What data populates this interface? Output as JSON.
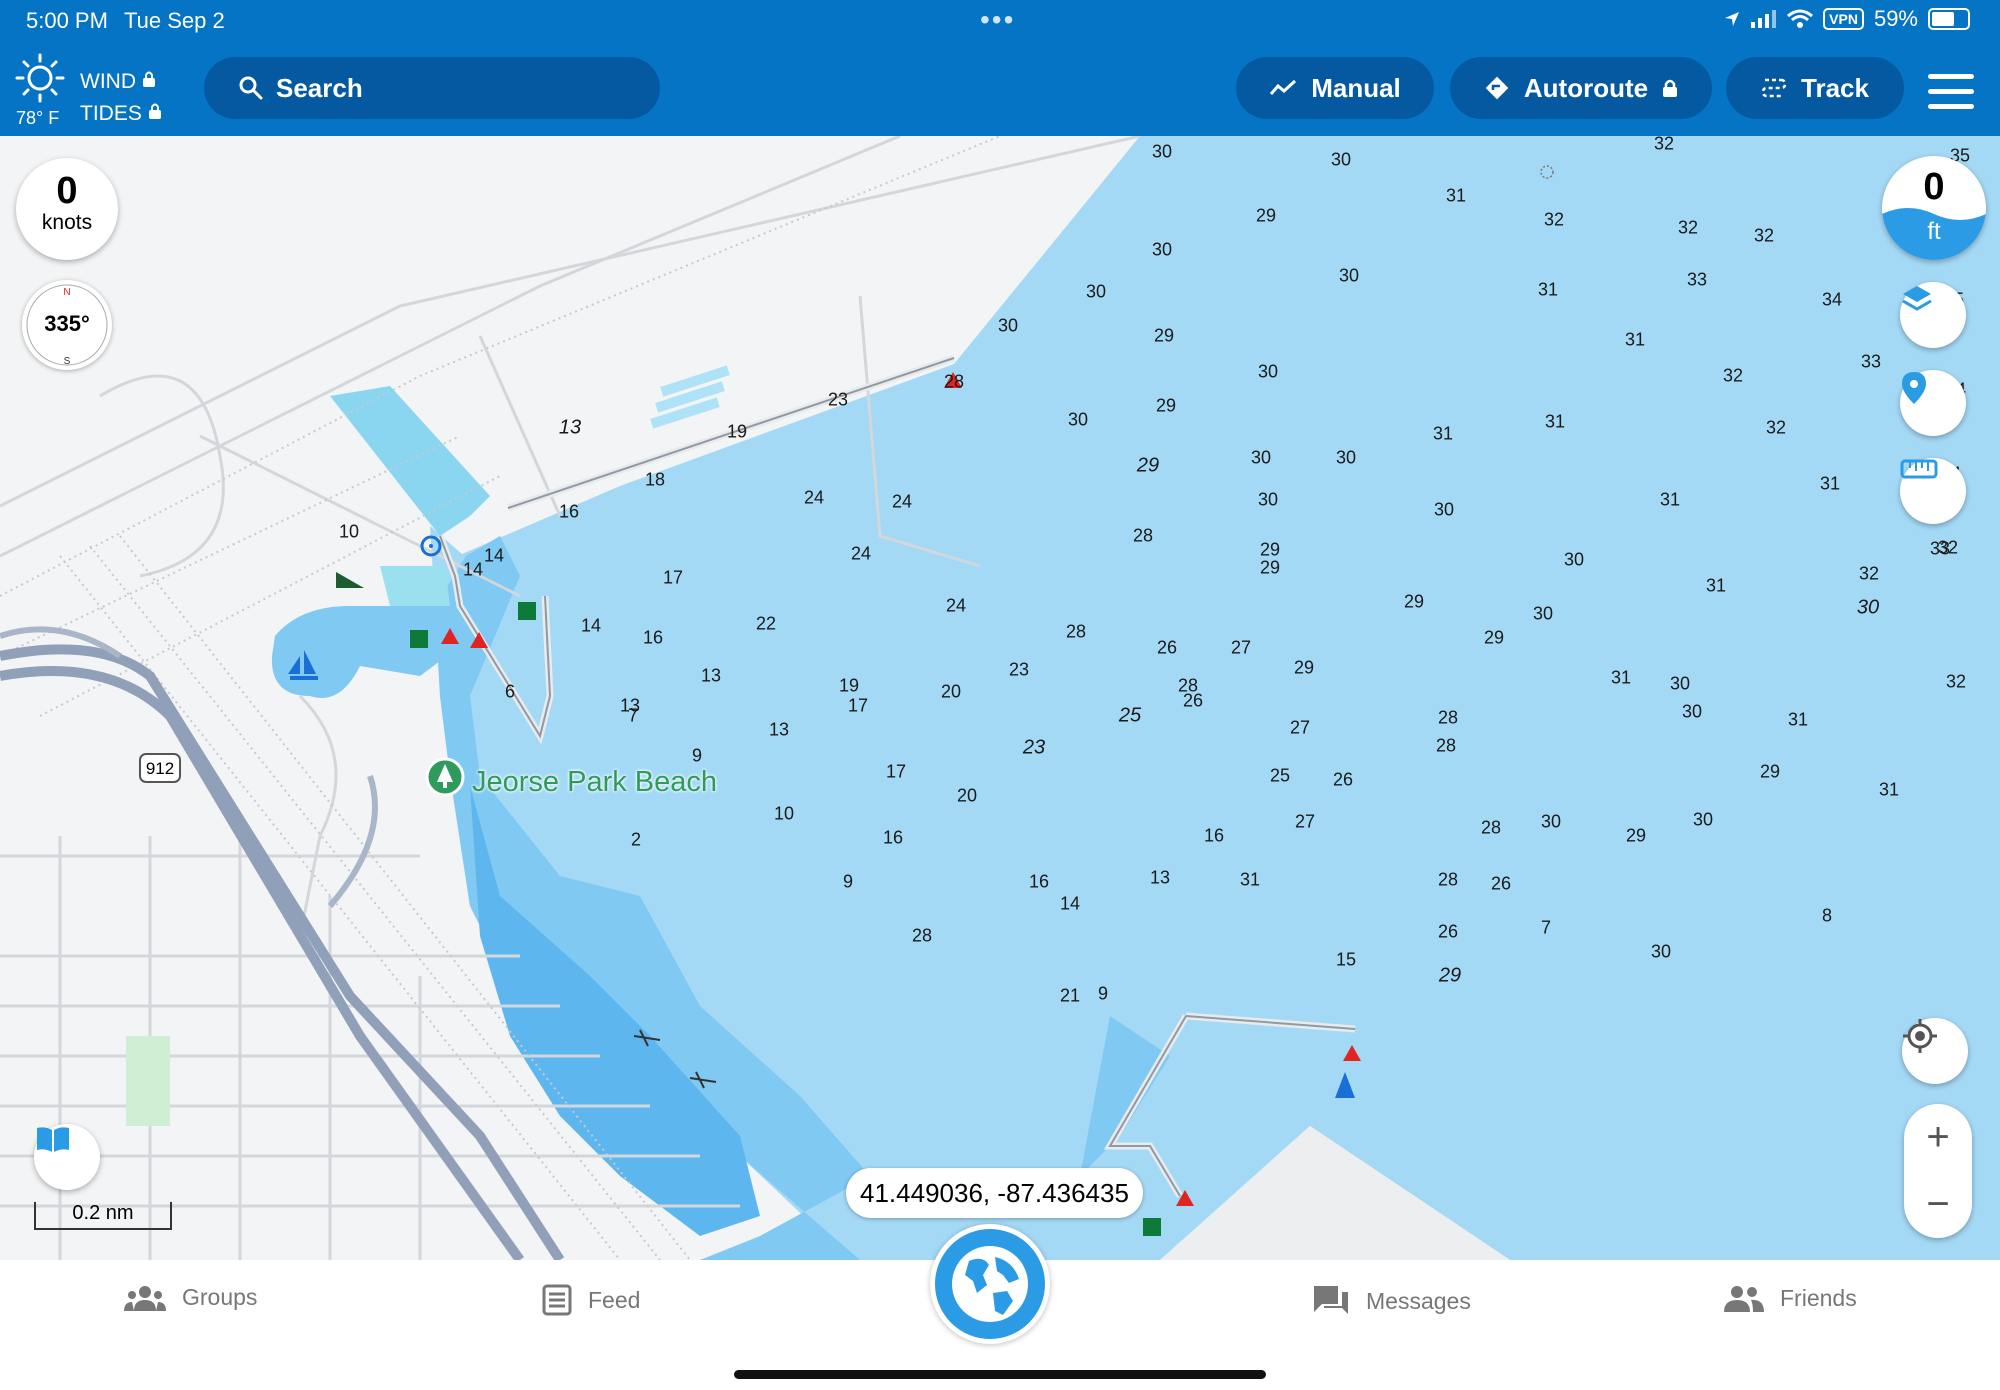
{
  "status_bar": {
    "time": "5:00 PM",
    "date": "Tue Sep 2",
    "vpn": "VPN",
    "battery": "59%",
    "battery_level": 0.59
  },
  "toolbar": {
    "temperature": "78° F",
    "wind_label": "WIND",
    "tides_label": "TIDES",
    "search_label": "Search",
    "manual_label": "Manual",
    "autoroute_label": "Autoroute",
    "track_label": "Track"
  },
  "map": {
    "speed_value": "0",
    "speed_unit": "knots",
    "heading": "335°",
    "depth_value": "0",
    "depth_unit": "ft",
    "place_name": "Jeorse Park Beach",
    "road_shield": "912",
    "coordinates": "41.449036, -87.436435",
    "scale_label": "0.2 nm",
    "zoom_in": "+",
    "zoom_out": "−",
    "soundings": [
      "30",
      "30",
      "32",
      "35",
      "31",
      "29",
      "32",
      "32",
      "32",
      "30",
      "30",
      "30",
      "31",
      "33",
      "34",
      "35",
      "30",
      "29",
      "31",
      "33",
      "28",
      "23",
      "30",
      "32",
      "34",
      "29",
      "30",
      "31",
      "31",
      "32",
      "13",
      "19",
      "30",
      "31",
      "29",
      "30",
      "34",
      "18",
      "24",
      "24",
      "30",
      "30",
      "31",
      "32",
      "16",
      "14",
      "10",
      "28",
      "29",
      "33",
      "14",
      "17",
      "24",
      "29",
      "30",
      "31",
      "24",
      "28",
      "29",
      "30",
      "22",
      "14",
      "16",
      "28",
      "30",
      "32",
      "29",
      "19",
      "26",
      "27",
      "29",
      "30",
      "13",
      "13",
      "23",
      "26",
      "25",
      "31",
      "32",
      "6",
      "20",
      "17",
      "27",
      "28",
      "30",
      "31",
      "7",
      "13",
      "9",
      "17",
      "23",
      "28",
      "29",
      "2",
      "20",
      "10",
      "16",
      "25",
      "26",
      "28",
      "16",
      "30",
      "31",
      "9",
      "16",
      "27",
      "28",
      "29",
      "30",
      "13",
      "9",
      "14",
      "31",
      "26",
      "7",
      "28",
      "30",
      "8",
      "15",
      "21",
      "29",
      "26"
    ]
  },
  "tab_bar": {
    "groups": "Groups",
    "feed": "Feed",
    "messages": "Messages",
    "friends": "Friends"
  },
  "colors": {
    "header": "#0574c4",
    "pill": "#0459a0",
    "deep_water": "#a4d9f5",
    "shallow_water": "#6fc0ef",
    "land": "#f3f4f5",
    "globe": "#2c9be6"
  }
}
